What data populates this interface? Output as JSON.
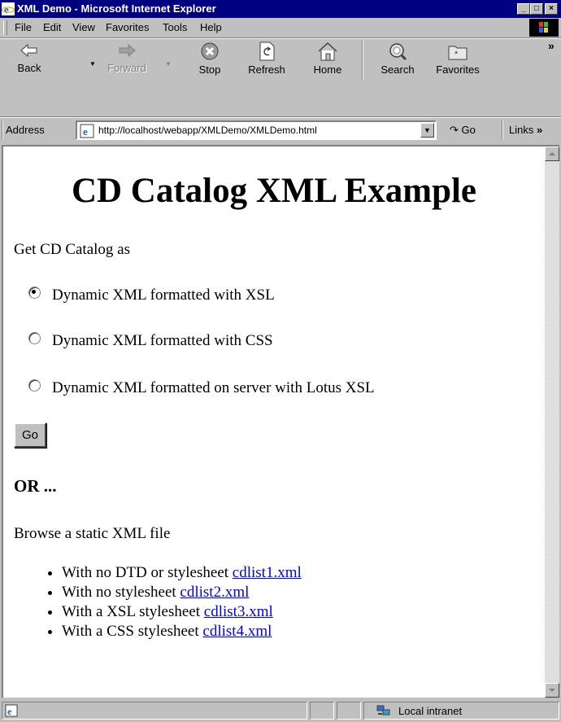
{
  "window": {
    "title": "XML Demo - Microsoft Internet Explorer",
    "controls": {
      "minimize": "_",
      "maximize": "□",
      "close": "×"
    }
  },
  "menu": {
    "items": [
      {
        "label": "File"
      },
      {
        "label": "Edit"
      },
      {
        "label": "View"
      },
      {
        "label": "Favorites"
      },
      {
        "label": "Tools"
      },
      {
        "label": "Help"
      }
    ]
  },
  "toolbar": {
    "back": "Back",
    "forward": "Forward",
    "stop": "Stop",
    "refresh": "Refresh",
    "home": "Home",
    "search": "Search",
    "favorites": "Favorites",
    "overflow": "»"
  },
  "address": {
    "label": "Address",
    "url": "http://localhost/webapp/XMLDemo/XMLDemo.html",
    "go": "Go",
    "links": "Links"
  },
  "page": {
    "title": "CD Catalog XML Example",
    "intro": "Get CD Catalog as",
    "options": [
      {
        "label": "Dynamic XML formatted with XSL",
        "selected": true
      },
      {
        "label": "Dynamic XML formatted with CSS",
        "selected": false
      },
      {
        "label": "Dynamic XML formatted on server with Lotus XSL",
        "selected": false
      }
    ],
    "submit": "Go",
    "or_heading": "OR ...",
    "browse_text": "Browse a static XML file",
    "files": [
      {
        "text": "With no DTD or stylesheet",
        "link": "cdlist1.xml"
      },
      {
        "text": "With no stylesheet",
        "link": "cdlist2.xml"
      },
      {
        "text": "With a XSL stylesheet",
        "link": "cdlist3.xml"
      },
      {
        "text": "With a CSS stylesheet",
        "link": "cdlist4.xml"
      }
    ]
  },
  "status": {
    "zone": "Local intranet"
  },
  "colors": {
    "title_bar": "#000080",
    "chrome": "#c0c0c0",
    "link": "#0000ee"
  }
}
